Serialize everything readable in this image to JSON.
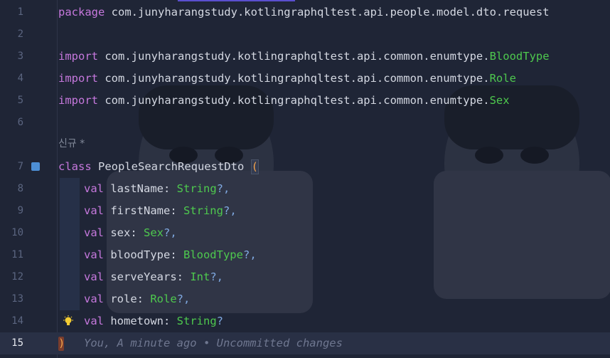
{
  "editor": {
    "current_line": 15,
    "lines": [
      {
        "n": "1",
        "t1": "package",
        "t2": " com.junyharangstudy.kotlingraphqltest.api.people.model.dto.request"
      },
      {
        "n": "2"
      },
      {
        "n": "3",
        "t1": "import",
        "t2": " com.junyharangstudy.kotlingraphqltest.api.common.enumtype.",
        "t3": "BloodType"
      },
      {
        "n": "4",
        "t1": "import",
        "t2": " com.junyharangstudy.kotlingraphqltest.api.common.enumtype.",
        "t3": "Role"
      },
      {
        "n": "5",
        "t1": "import",
        "t2": " com.junyharangstudy.kotlingraphqltest.api.common.enumtype.",
        "t3": "Sex"
      },
      {
        "n": "6"
      },
      {
        "n": "7",
        "t1": "class",
        "t2": " PeopleSearchRequestDto ",
        "t3": "("
      },
      {
        "n": "8",
        "t1": "val",
        "t2": " lastName: ",
        "t3": "String",
        "t4": "?,"
      },
      {
        "n": "9",
        "t1": "val",
        "t2": " firstName: ",
        "t3": "String",
        "t4": "?,"
      },
      {
        "n": "10",
        "t1": "val",
        "t2": " sex: ",
        "t3": "Sex",
        "t4": "?,"
      },
      {
        "n": "11",
        "t1": "val",
        "t2": " bloodType: ",
        "t3": "BloodType",
        "t4": "?,"
      },
      {
        "n": "12",
        "t1": "val",
        "t2": " serveYears: ",
        "t3": "Int",
        "t4": "?,"
      },
      {
        "n": "13",
        "t1": "val",
        "t2": " role: ",
        "t3": "Role",
        "t4": "?,"
      },
      {
        "n": "14",
        "t1": "val",
        "t2": " hometown: ",
        "t3": "String",
        "t4": "?"
      },
      {
        "n": "15",
        "t1": ")",
        "blame": "You, A minute ago • Uncommitted changes"
      }
    ],
    "codelens": "신규 *",
    "gutter_icon": "edit-icon",
    "hint_icon": "lightbulb-icon"
  },
  "colors": {
    "background": "#1f2536",
    "keyword": "#c678dd",
    "type": "#4ec94e",
    "paren": "#f1a24b"
  }
}
